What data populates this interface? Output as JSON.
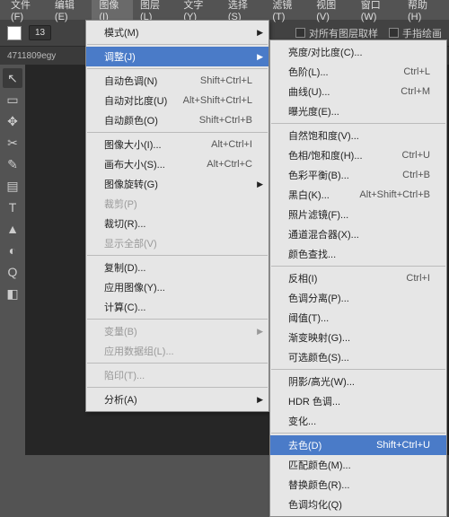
{
  "menubar": [
    "文件(F)",
    "编辑(E)",
    "图像(I)",
    "图层(L)",
    "文字(Y)",
    "选择(S)",
    "滤镜(T)",
    "视图(V)",
    "窗口(W)",
    "帮助(H)"
  ],
  "menubar_active": 2,
  "toolbar": {
    "num": "13",
    "checks": [
      "对所有图层取样",
      "手指绘画"
    ]
  },
  "filetab": "4711809egy",
  "menu1": [
    {
      "t": "l",
      "label": "模式(M)",
      "arrow": true
    },
    {
      "t": "s"
    },
    {
      "t": "l",
      "label": "调整(J)",
      "arrow": true,
      "hl": true
    },
    {
      "t": "s"
    },
    {
      "t": "l",
      "label": "自动色调(N)",
      "sc": "Shift+Ctrl+L"
    },
    {
      "t": "l",
      "label": "自动对比度(U)",
      "sc": "Alt+Shift+Ctrl+L"
    },
    {
      "t": "l",
      "label": "自动颜色(O)",
      "sc": "Shift+Ctrl+B"
    },
    {
      "t": "s"
    },
    {
      "t": "l",
      "label": "图像大小(I)...",
      "sc": "Alt+Ctrl+I"
    },
    {
      "t": "l",
      "label": "画布大小(S)...",
      "sc": "Alt+Ctrl+C"
    },
    {
      "t": "l",
      "label": "图像旋转(G)",
      "arrow": true
    },
    {
      "t": "l",
      "label": "裁剪(P)",
      "dis": true
    },
    {
      "t": "l",
      "label": "裁切(R)..."
    },
    {
      "t": "l",
      "label": "显示全部(V)",
      "dis": true
    },
    {
      "t": "s"
    },
    {
      "t": "l",
      "label": "复制(D)..."
    },
    {
      "t": "l",
      "label": "应用图像(Y)..."
    },
    {
      "t": "l",
      "label": "计算(C)..."
    },
    {
      "t": "s"
    },
    {
      "t": "l",
      "label": "变量(B)",
      "arrow": true,
      "dis": true
    },
    {
      "t": "l",
      "label": "应用数据组(L)...",
      "dis": true
    },
    {
      "t": "s"
    },
    {
      "t": "l",
      "label": "陷印(T)...",
      "dis": true
    },
    {
      "t": "s"
    },
    {
      "t": "l",
      "label": "分析(A)",
      "arrow": true
    }
  ],
  "menu2": [
    {
      "t": "l",
      "label": "亮度/对比度(C)..."
    },
    {
      "t": "l",
      "label": "色阶(L)...",
      "sc": "Ctrl+L"
    },
    {
      "t": "l",
      "label": "曲线(U)...",
      "sc": "Ctrl+M"
    },
    {
      "t": "l",
      "label": "曝光度(E)..."
    },
    {
      "t": "s"
    },
    {
      "t": "l",
      "label": "自然饱和度(V)..."
    },
    {
      "t": "l",
      "label": "色相/饱和度(H)...",
      "sc": "Ctrl+U"
    },
    {
      "t": "l",
      "label": "色彩平衡(B)...",
      "sc": "Ctrl+B"
    },
    {
      "t": "l",
      "label": "黑白(K)...",
      "sc": "Alt+Shift+Ctrl+B"
    },
    {
      "t": "l",
      "label": "照片滤镜(F)..."
    },
    {
      "t": "l",
      "label": "通道混合器(X)..."
    },
    {
      "t": "l",
      "label": "颜色查找..."
    },
    {
      "t": "s"
    },
    {
      "t": "l",
      "label": "反相(I)",
      "sc": "Ctrl+I"
    },
    {
      "t": "l",
      "label": "色调分离(P)..."
    },
    {
      "t": "l",
      "label": "阈值(T)..."
    },
    {
      "t": "l",
      "label": "渐变映射(G)..."
    },
    {
      "t": "l",
      "label": "可选颜色(S)..."
    },
    {
      "t": "s"
    },
    {
      "t": "l",
      "label": "阴影/高光(W)..."
    },
    {
      "t": "l",
      "label": "HDR 色调..."
    },
    {
      "t": "l",
      "label": "变化..."
    },
    {
      "t": "s"
    },
    {
      "t": "l",
      "label": "去色(D)",
      "sc": "Shift+Ctrl+U",
      "hl": true
    },
    {
      "t": "l",
      "label": "匹配颜色(M)..."
    },
    {
      "t": "l",
      "label": "替换颜色(R)..."
    },
    {
      "t": "l",
      "label": "色调均化(Q)"
    }
  ],
  "tools": [
    "↖",
    "▭",
    "✥",
    "✂",
    "✎",
    "▤",
    "T",
    "▲",
    "◐",
    "Q",
    "◧"
  ]
}
